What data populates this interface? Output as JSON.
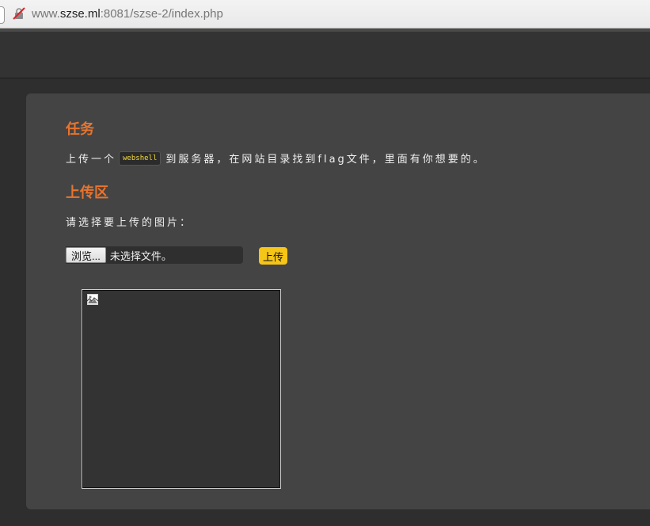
{
  "browser": {
    "url_prefix": "www.",
    "url_host": "szse.ml",
    "url_rest": ":8081/szse-2/index.php",
    "site_icon": "insecure-connection-icon"
  },
  "task": {
    "title": "任务",
    "text_before": "上传一个",
    "code": "webshell",
    "text_after": "到服务器，在网站目录找到flag文件，里面有你想要的。"
  },
  "upload": {
    "title": "上传区",
    "select_label": "请选择要上传的图片：",
    "browse_label": "浏览...",
    "file_status": "未选择文件。",
    "submit_label": "上传"
  },
  "preview": {
    "icon": "broken-image-icon"
  },
  "colors": {
    "heading": "#e8742e",
    "upload_button": "#f5c518",
    "code_text": "#f7dd3a"
  }
}
